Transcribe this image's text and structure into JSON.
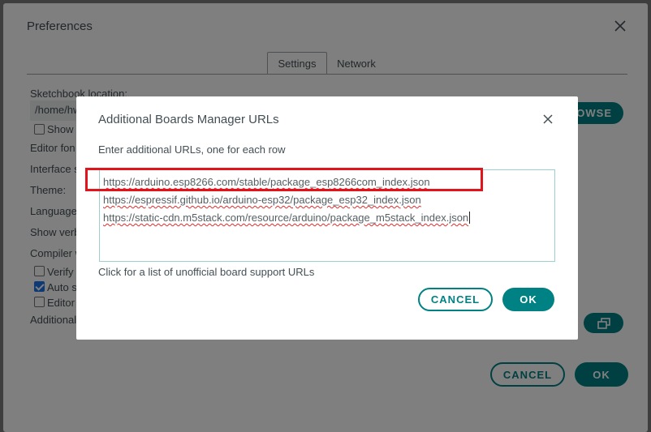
{
  "preferences": {
    "title": "Preferences",
    "tabs": [
      {
        "label": "Settings",
        "active": true
      },
      {
        "label": "Network",
        "active": false
      }
    ],
    "sketchbook_label": "Sketchbook location:",
    "sketchbook_value": "/home/hw",
    "browse_label": "OWSE",
    "show_label": "Show",
    "editor_font_label": "Editor fon",
    "interface_label": "Interface s",
    "theme_label": "Theme:",
    "language_label": "Language",
    "show_verbose_label": "Show verb",
    "compiler_label": "Compiler w",
    "verify_label": "Verify",
    "auto_save_label": "Auto s",
    "auto_save_checked": true,
    "editor_label": "Editor",
    "additional_label": "Additional",
    "cancel_label": "CANCEL",
    "ok_label": "OK"
  },
  "dialog": {
    "title": "Additional Boards Manager URLs",
    "instruction": "Enter additional URLs, one for each row",
    "urls": [
      "https://arduino.esp8266.com/stable/package_esp8266com_index.json",
      "https://espressif.github.io/arduino-esp32/package_esp32_index.json",
      "https://static-cdn.m5stack.com/resource/arduino/package_m5stack_index.json"
    ],
    "link_text": "Click for a list of unofficial board support URLs",
    "cancel_label": "CANCEL",
    "ok_label": "OK"
  },
  "colors": {
    "accent": "#008184",
    "highlight": "#e1141c"
  }
}
